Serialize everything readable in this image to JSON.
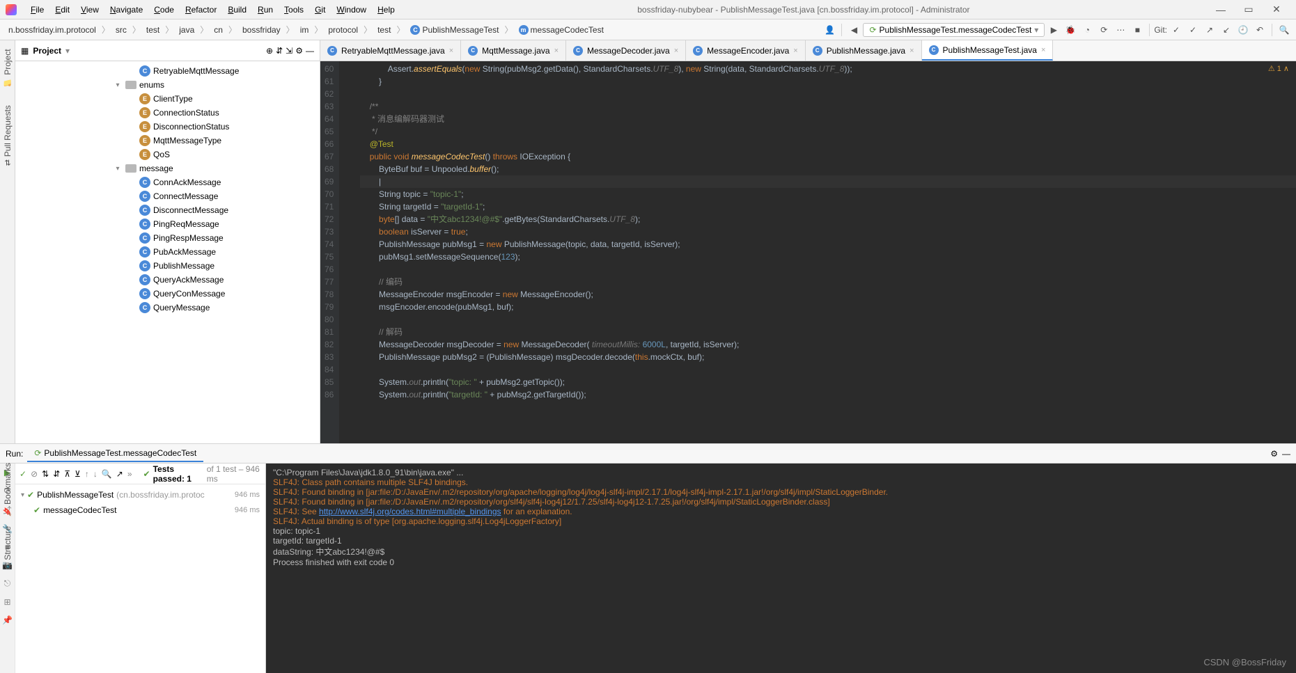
{
  "title": "bossfriday-nubybear - PublishMessageTest.java [cn.bossfriday.im.protocol] - Administrator",
  "menus": [
    "File",
    "Edit",
    "View",
    "Navigate",
    "Code",
    "Refactor",
    "Build",
    "Run",
    "Tools",
    "Git",
    "Window",
    "Help"
  ],
  "breadcrumbs": [
    "n.bossfriday.im.protocol",
    "src",
    "test",
    "java",
    "cn",
    "bossfriday",
    "im",
    "protocol",
    "test",
    "PublishMessageTest",
    "messageCodecTest"
  ],
  "run_config": "PublishMessageTest.messageCodecTest",
  "git_label": "Git:",
  "vtabs_left_top": [
    "Project",
    "Pull Requests"
  ],
  "vtabs_left_bottom": [
    "Bookmarks",
    "Structure"
  ],
  "project_title": "Project",
  "tree": [
    {
      "indent": 160,
      "icon": "C",
      "label": "RetryableMqttMessage"
    },
    {
      "indent": 140,
      "arrow": "▾",
      "folder": true,
      "label": "enums"
    },
    {
      "indent": 160,
      "icon": "E",
      "label": "ClientType"
    },
    {
      "indent": 160,
      "icon": "E",
      "label": "ConnectionStatus"
    },
    {
      "indent": 160,
      "icon": "E",
      "label": "DisconnectionStatus"
    },
    {
      "indent": 160,
      "icon": "E",
      "label": "MqttMessageType"
    },
    {
      "indent": 160,
      "icon": "E",
      "label": "QoS"
    },
    {
      "indent": 140,
      "arrow": "▾",
      "folder": true,
      "label": "message"
    },
    {
      "indent": 160,
      "icon": "C",
      "label": "ConnAckMessage"
    },
    {
      "indent": 160,
      "icon": "C",
      "label": "ConnectMessage"
    },
    {
      "indent": 160,
      "icon": "C",
      "label": "DisconnectMessage"
    },
    {
      "indent": 160,
      "icon": "C",
      "label": "PingReqMessage"
    },
    {
      "indent": 160,
      "icon": "C",
      "label": "PingRespMessage"
    },
    {
      "indent": 160,
      "icon": "C",
      "label": "PubAckMessage"
    },
    {
      "indent": 160,
      "icon": "C",
      "label": "PublishMessage"
    },
    {
      "indent": 160,
      "icon": "C",
      "label": "QueryAckMessage"
    },
    {
      "indent": 160,
      "icon": "C",
      "label": "QueryConMessage"
    },
    {
      "indent": 160,
      "icon": "C",
      "label": "QueryMessage"
    }
  ],
  "tabs": [
    {
      "label": "RetryableMqttMessage.java",
      "active": false
    },
    {
      "label": "MqttMessage.java",
      "active": false
    },
    {
      "label": "MessageDecoder.java",
      "active": false
    },
    {
      "label": "MessageEncoder.java",
      "active": false
    },
    {
      "label": "PublishMessage.java",
      "active": false
    },
    {
      "label": "PublishMessageTest.java",
      "active": true
    }
  ],
  "editor_warn": "⚠ 1 ∧",
  "line_start": 60,
  "line_end": 86,
  "run_tab": "PublishMessageTest.messageCodecTest",
  "run_label": "Run:",
  "tests_passed": "Tests passed: 1",
  "tests_total": " of 1 test – 946 ms",
  "test_rows": [
    {
      "name": "PublishMessageTest",
      "suffix": "(cn.bossfriday.im.protoc",
      "time": "946 ms",
      "indent": 0,
      "arrow": true
    },
    {
      "name": "messageCodecTest",
      "time": "946 ms",
      "indent": 18
    }
  ],
  "console": [
    {
      "cls": "",
      "text": "\"C:\\Program Files\\Java\\jdk1.8.0_91\\bin\\java.exe\" ..."
    },
    {
      "cls": "cwarn",
      "text": "SLF4J: Class path contains multiple SLF4J bindings."
    },
    {
      "cls": "cwarn",
      "text": "SLF4J: Found binding in [jar:file:/D:/JavaEnv/.m2/repository/org/apache/logging/log4j/log4j-slf4j-impl/2.17.1/log4j-slf4j-impl-2.17.1.jar!/org/slf4j/impl/StaticLoggerBinder."
    },
    {
      "cls": "cwarn",
      "text": "SLF4J: Found binding in [jar:file:/D:/JavaEnv/.m2/repository/org/slf4j/slf4j-log4j12/1.7.25/slf4j-log4j12-1.7.25.jar!/org/slf4j/impl/StaticLoggerBinder.class]"
    },
    {
      "cls": "cwarn",
      "html": "SLF4J: See <span class='clink'>http://www.slf4j.org/codes.html#multiple_bindings</span> for an explanation."
    },
    {
      "cls": "cwarn",
      "text": "SLF4J: Actual binding is of type [org.apache.logging.slf4j.Log4jLoggerFactory]"
    },
    {
      "cls": "",
      "text": "topic: topic-1"
    },
    {
      "cls": "",
      "text": "targetId: targetId-1"
    },
    {
      "cls": "",
      "text": "dataString: 中文abc1234!@#$"
    },
    {
      "cls": "",
      "text": ""
    },
    {
      "cls": "",
      "text": "Process finished with exit code 0"
    }
  ],
  "watermark": "CSDN @BossFriday"
}
